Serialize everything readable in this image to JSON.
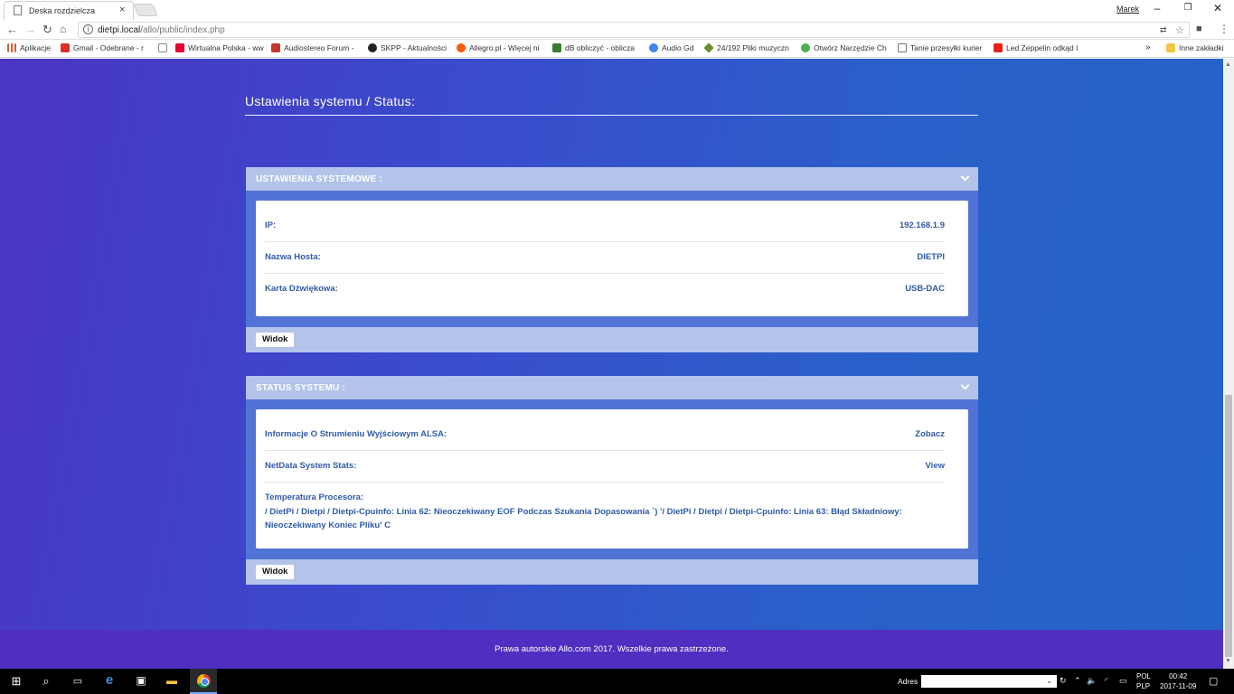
{
  "browser": {
    "tab_title": "Deska rozdzielcza",
    "tab_close": "×",
    "user_name": "Marek",
    "window_controls": {
      "minimize": "–",
      "restore": "❐",
      "close": "✕"
    },
    "url_host": "dietpi.local",
    "url_path": "/allo/public/index.php",
    "bookmarks": [
      {
        "label": "Aplikacje",
        "icon_color": "#e05a2b"
      },
      {
        "label": "Gmail - Odebrane - r",
        "icon_color": "#d93025"
      },
      {
        "label": "",
        "icon_color": "#888888"
      },
      {
        "label": "Wirtualna Polska - ww",
        "icon_color": "#e4002b"
      },
      {
        "label": "Audiostereo Forum -",
        "icon_color": "#c0392b"
      },
      {
        "label": "SKPP - Aktualności",
        "icon_color": "#222222"
      },
      {
        "label": "Allegro.pl - Więcej ni",
        "icon_color": "#ff5a00"
      },
      {
        "label": "dB obliczyć - oblicza",
        "icon_color": "#3b7d2f"
      },
      {
        "label": "Audio Gd",
        "icon_color": "#4285f4"
      },
      {
        "label": "24/192 Pliki muzyczn",
        "icon_color": "#6a8f2a"
      },
      {
        "label": "Otwórz Narzędzie Ch",
        "icon_color": "#4caf50"
      },
      {
        "label": "Tanie przesyłki kurier",
        "icon_color": "#777777"
      },
      {
        "label": "Led Zeppelin odkąd I",
        "icon_color": "#e62117"
      },
      {
        "label": "»",
        "icon_color": ""
      },
      {
        "label": "Inne zakładki",
        "icon_color": "#f4c542"
      }
    ]
  },
  "page": {
    "title": "Ustawienia systemu / Status:",
    "system_settings": {
      "header": "USTAWIENIA SYSTEMOWE :",
      "rows": [
        {
          "label": "IP:",
          "value": "192.168.1.9"
        },
        {
          "label": "Nazwa Hosta:",
          "value": "DIETPI"
        },
        {
          "label": "Karta Dźwiękowa:",
          "value": "USB-DAC"
        }
      ],
      "button": "Widok"
    },
    "system_status": {
      "header": "STATUS SYSTEMU :",
      "rows": [
        {
          "label": "Informacje O Strumieniu Wyjściowym ALSA:",
          "value": "Zobacz"
        },
        {
          "label": "NetData System Stats:",
          "value": "View"
        }
      ],
      "temperature_label": "Temperatura Procesora:",
      "temperature_value": "/ DietPi / Dietpi / Dietpi-Cpuinfo: Linia 62: Nieoczekiwany EOF Podczas Szukania Dopasowania `) '/ DietPi / Dietpi / Dietpi-Cpuinfo: Linia 63: Błąd Składniowy: Nieoczekiwany Koniec Pliku' C",
      "button": "Widok"
    },
    "footer": "Prawa autorskie Allo.com 2017. Wszelkie prawa zastrzeżone."
  },
  "taskbar": {
    "adres_label": "Adres",
    "lang_line1": "POL",
    "lang_line2": "PLP",
    "time": "00:42",
    "date": "2017-11-09"
  }
}
